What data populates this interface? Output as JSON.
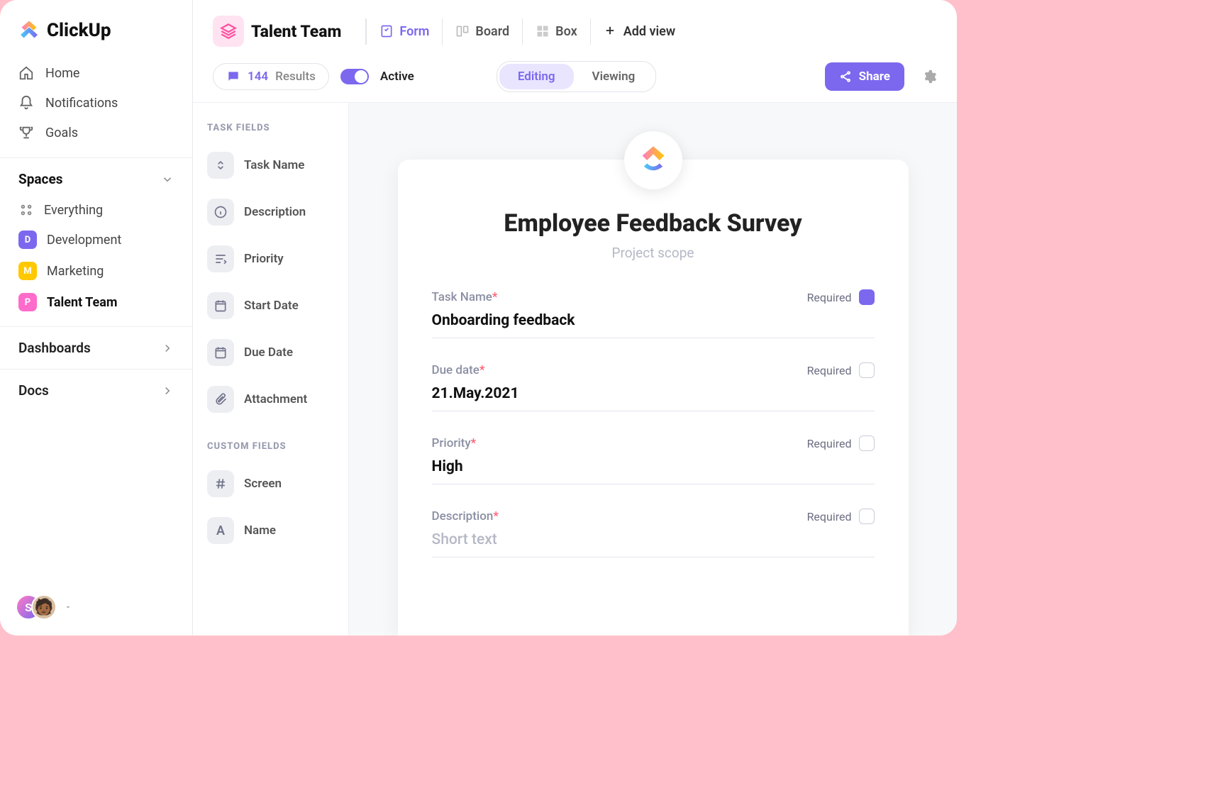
{
  "app": {
    "name": "ClickUp"
  },
  "sidebar": {
    "nav": [
      {
        "icon": "home",
        "label": "Home"
      },
      {
        "icon": "bell",
        "label": "Notifications"
      },
      {
        "icon": "trophy",
        "label": "Goals"
      }
    ],
    "spaces_label": "Spaces",
    "everything_label": "Everything",
    "spaces": [
      {
        "letter": "D",
        "label": "Development",
        "color": "purple"
      },
      {
        "letter": "M",
        "label": "Marketing",
        "color": "yellow"
      },
      {
        "letter": "P",
        "label": "Talent Team",
        "color": "pink",
        "active": true
      }
    ],
    "sections": [
      {
        "label": "Dashboards"
      },
      {
        "label": "Docs"
      }
    ],
    "user_initial": "S"
  },
  "header": {
    "folder_title": "Talent Team",
    "views": [
      {
        "label": "Form",
        "active": true
      },
      {
        "label": "Board"
      },
      {
        "label": "Box"
      }
    ],
    "add_view_label": "Add view"
  },
  "toolbar": {
    "results_count": "144",
    "results_label": "Results",
    "toggle_label": "Active",
    "toggle_on": true,
    "segments": [
      {
        "label": "Editing",
        "active": true
      },
      {
        "label": "Viewing"
      }
    ],
    "share_label": "Share"
  },
  "field_panel": {
    "task_fields_label": "TASK FIELDS",
    "task_fields": [
      {
        "icon": "task-name",
        "label": "Task Name"
      },
      {
        "icon": "description",
        "label": "Description"
      },
      {
        "icon": "priority",
        "label": "Priority"
      },
      {
        "icon": "date",
        "label": "Start Date"
      },
      {
        "icon": "date",
        "label": "Due Date"
      },
      {
        "icon": "attachment",
        "label": "Attachment"
      }
    ],
    "custom_fields_label": "CUSTOM FIELDS",
    "custom_fields": [
      {
        "icon": "hash",
        "label": "Screen"
      },
      {
        "icon": "text",
        "label": "Name"
      }
    ]
  },
  "form": {
    "title": "Employee Feedback Survey",
    "subtitle": "Project scope",
    "required_label": "Required",
    "fields": [
      {
        "label": "Task Name",
        "required": true,
        "req_checked": true,
        "value": "Onboarding feedback"
      },
      {
        "label": "Due date",
        "required": true,
        "req_checked": false,
        "value": "21.May.2021"
      },
      {
        "label": "Priority",
        "required": true,
        "req_checked": false,
        "value": "High"
      },
      {
        "label": "Description",
        "required": true,
        "req_checked": false,
        "value": "Short text",
        "placeholder": true
      }
    ]
  }
}
